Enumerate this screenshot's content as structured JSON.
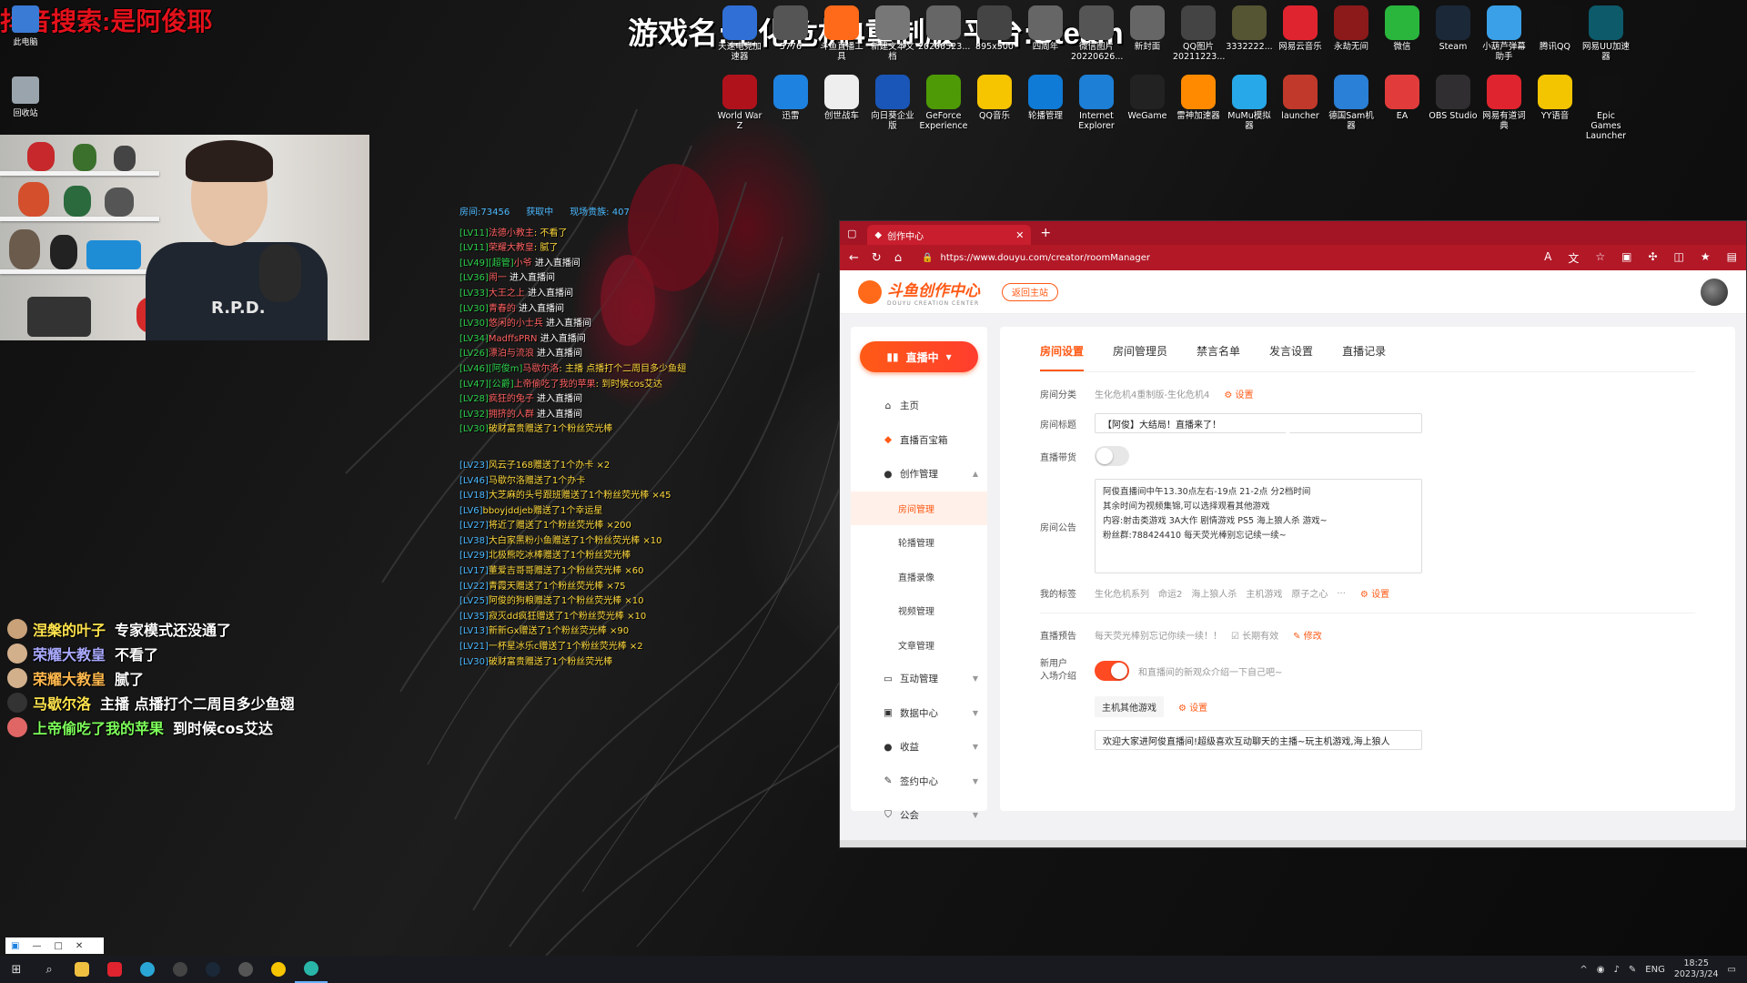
{
  "overlay": {
    "stream_title": "抖音搜索:是阿俊耶",
    "game_title": "游戏名:生化危机4重制版 平台:Steam"
  },
  "left_desktop": [
    {
      "label": "此电脑",
      "icon": "computer-icon"
    },
    {
      "label": "回收站",
      "icon": "recycle-bin-icon"
    }
  ],
  "desktop_icons_row1": [
    {
      "label": "天速电竞加速器",
      "color": "#2f6fd6"
    },
    {
      "label": "5776",
      "color": "#555"
    },
    {
      "label": "斗鱼直播工具",
      "color": "#ff6a1a"
    },
    {
      "label": "新建文本文档",
      "color": "#777"
    },
    {
      "label": "20200523...",
      "color": "#666"
    },
    {
      "label": "895x500",
      "color": "#444"
    },
    {
      "label": "四周年",
      "color": "#666"
    },
    {
      "label": "微信图片20220626...",
      "color": "#555"
    },
    {
      "label": "新封面",
      "color": "#666"
    },
    {
      "label": "QQ图片20211223...",
      "color": "#444"
    },
    {
      "label": "3332222...",
      "color": "#553"
    },
    {
      "label": "网易云音乐",
      "color": "#e0242f"
    },
    {
      "label": "永劫无间",
      "color": "#8c1a1a"
    },
    {
      "label": "微信",
      "color": "#2ab53d"
    },
    {
      "label": "Steam",
      "color": "#1b2838"
    },
    {
      "label": "小葫芦弹幕助手",
      "color": "#3aa0e8"
    },
    {
      "label": "腾讯QQ",
      "color": "#111"
    },
    {
      "label": "网易UU加速器",
      "color": "#0c5a6a"
    }
  ],
  "desktop_icons_row2": [
    {
      "label": "World War Z",
      "color": "#b0121c"
    },
    {
      "label": "迅雷",
      "color": "#1e82e0"
    },
    {
      "label": "创世战车",
      "color": "#eee"
    },
    {
      "label": "向日葵企业版",
      "color": "#1a56b8"
    },
    {
      "label": "GeForce Experience",
      "color": "#4e9a06"
    },
    {
      "label": "QQ音乐",
      "color": "#f7c400"
    },
    {
      "label": "轮播管理",
      "color": "#0f7bd6"
    },
    {
      "label": "Internet Explorer",
      "color": "#1d7fd6"
    },
    {
      "label": "WeGame",
      "color": "#222"
    },
    {
      "label": "雷神加速器",
      "color": "#ff8a00"
    },
    {
      "label": "MuMu模拟器",
      "color": "#27a8e8"
    },
    {
      "label": "launcher",
      "color": "#c0392b"
    },
    {
      "label": "德国Sam机器",
      "color": "#2a7fd6"
    },
    {
      "label": "EA",
      "color": "#e23b3b"
    },
    {
      "label": "OBS Studio",
      "color": "#302e31"
    },
    {
      "label": "网易有道词典",
      "color": "#e0242f"
    },
    {
      "label": "YY语音",
      "color": "#f3c400"
    },
    {
      "label": "Epic Games Launcher",
      "color": "#111"
    }
  ],
  "bullets": [
    {
      "user": "涅槃的叶子",
      "msg": "专家模式还没通了",
      "ucolor": "#ffe44d",
      "av": "#c9a27a"
    },
    {
      "user": "荣耀大教皇",
      "msg": "不看了",
      "ucolor": "#a9a9ff",
      "av": "#d3b08c"
    },
    {
      "user": "荣耀大教皇",
      "msg": "腻了",
      "ucolor": "#ffb84d",
      "av": "#d3b08c"
    },
    {
      "user": "马歇尔洛",
      "msg": "主播 点播打个二周目多少鱼翅",
      "ucolor": "#ffe44d",
      "av": "#333"
    },
    {
      "user": "上帝偷吃了我的苹果",
      "msg": "到时候cos艾达",
      "ucolor": "#7dff5a",
      "av": "#e06666"
    }
  ],
  "chatlog": {
    "header": [
      "房间:73456",
      "获取中",
      "现场贵族: 407"
    ],
    "rows1": [
      {
        "lv": "[LV11]",
        "nm": "法德小教主",
        "txt": ": 不看了",
        "type": "say"
      },
      {
        "lv": "[LV11]",
        "nm": "荣耀大教皇",
        "txt": ": 腻了",
        "type": "say"
      },
      {
        "lv": "[LV49][超管]",
        "nm": "小爷",
        "txt": " 进入直播间",
        "type": "enter"
      },
      {
        "lv": "[LV36]",
        "nm": "闹一",
        "txt": " 进入直播间",
        "type": "enter"
      },
      {
        "lv": "[LV33]",
        "nm": "大王之上",
        "txt": " 进入直播间",
        "type": "enter"
      },
      {
        "lv": "[LV30]",
        "nm": "青春的",
        "txt": " 进入直播间",
        "type": "enter"
      },
      {
        "lv": "[LV30]",
        "nm": "悠闲的小士兵",
        "txt": " 进入直播间",
        "type": "enter"
      },
      {
        "lv": "[LV34]",
        "nm": "MadffsPRN",
        "txt": " 进入直播间",
        "type": "enter"
      },
      {
        "lv": "[LV26]",
        "nm": "漂泊与流浪",
        "txt": " 进入直播间",
        "type": "enter"
      },
      {
        "lv": "[LV46][阿俊m]",
        "nm": "马歇尔洛",
        "txt": ": 主播 点播打个二周目多少鱼翅",
        "type": "say"
      },
      {
        "lv": "[LV47][公爵]",
        "nm": "上帝偷吃了我的苹果",
        "txt": ": 到时候cos艾达",
        "type": "say"
      },
      {
        "lv": "[LV28]",
        "nm": "疯狂的兔子",
        "txt": " 进入直播间",
        "type": "enter"
      },
      {
        "lv": "[LV32]",
        "nm": "拥挤的人群",
        "txt": " 进入直播间",
        "type": "enter"
      },
      {
        "lv": "[LV30]",
        "nm": "",
        "txt": "破财富贵赠送了1个粉丝荧光棒",
        "type": "gift"
      }
    ],
    "rows2": [
      {
        "lv": "[LV23]",
        "txt": "风云子168赠送了1个办卡 ×2"
      },
      {
        "lv": "[LV46]",
        "txt": "马歇尔洛赠送了1个办卡"
      },
      {
        "lv": "[LV18]",
        "txt": "大芝麻的头号跟班赠送了1个粉丝荧光棒 ×45"
      },
      {
        "lv": "[LV6]",
        "txt": "bboyjddjeb赠送了1个幸运星"
      },
      {
        "lv": "[LV27]",
        "txt": "将近了赠送了1个粉丝荧光棒 ×200"
      },
      {
        "lv": "[LV38]",
        "txt": "大白家黑粉小鱼赠送了1个粉丝荧光棒 ×10"
      },
      {
        "lv": "[LV29]",
        "txt": "北极熊吃冰棒赠送了1个粉丝荧光棒"
      },
      {
        "lv": "[LV17]",
        "txt": "董爱吉哥哥赠送了1个粉丝荧光棒 ×60"
      },
      {
        "lv": "[LV22]",
        "txt": "青霞天赠送了1个粉丝荧光棒 ×75"
      },
      {
        "lv": "[LV25]",
        "txt": "阿俊的狗粮赠送了1个粉丝荧光棒 ×10"
      },
      {
        "lv": "[LV35]",
        "txt": "寂灭dd疯狂赠送了1个粉丝荧光棒 ×10"
      },
      {
        "lv": "[LV13]",
        "txt": "新新Gx赠送了1个粉丝荧光棒 ×90"
      },
      {
        "lv": "[LV21]",
        "txt": "一杯星冰乐c赠送了1个粉丝荧光棒 ×2"
      },
      {
        "lv": "[LV30]",
        "txt": "破财富贵赠送了1个粉丝荧光棒"
      }
    ]
  },
  "browser": {
    "tab_title": "创作中心",
    "url": "https://www.douyu.com/creator/roomManager",
    "logo_text": "斗鱼创作中心",
    "logo_sub": "DOUYU CREATION CENTER",
    "back_label": "返回主站",
    "live_label": "直播中",
    "nav": {
      "home": "主页",
      "treasure": "直播百宝箱",
      "creation": "创作管理",
      "sub": [
        "房间管理",
        "轮播管理",
        "直播录像",
        "视频管理",
        "文章管理"
      ],
      "interaction": "互动管理",
      "data": "数据中心",
      "income": "收益",
      "contract": "签约中心",
      "guild": "公会"
    },
    "tabs": [
      "房间设置",
      "房间管理员",
      "禁言名单",
      "发言设置",
      "直播记录"
    ],
    "form": {
      "category_label": "房间分类",
      "category_value": "生化危机4重制版-生化危机4",
      "settings_link": "设置",
      "title_label": "房间标题",
      "title_value": "【阿俊】大结局！直播来了！",
      "goods_label": "直播带货",
      "notice_label": "房间公告",
      "notice_lines": [
        "阿俊直播间中午13.30点左右-19点 21-2点 分2档时间",
        "其余时间为视频集锦,可以选择观看其他游戏",
        "内容:射击类游戏 3A大作 剧情游戏 PS5 海上狼人杀 游戏~",
        "粉丝群:788424410 每天荧光棒别忘记续一续~"
      ],
      "tags_label": "我的标签",
      "tags": [
        "生化危机系列",
        "命运2",
        "海上狼人杀",
        "主机游戏",
        "原子之心",
        "..."
      ],
      "preview_label": "直播预告",
      "preview_value": "每天荧光棒别忘记你续一续！！",
      "long_valid": "长期有效",
      "modify_link": "修改",
      "newuser_label_1": "新用户",
      "newuser_label_2": "入场介绍",
      "newuser_hint": "和直播间的新观众介绍一下自己吧~",
      "chip": "主机其他游戏",
      "intro_value": "欢迎大家进阿俊直播间!超级喜欢互动聊天的主播~玩主机游戏,海上狼人"
    }
  },
  "mini_window": {
    "icon": "app-icon",
    "min": "—",
    "max": "□",
    "close": "✕"
  },
  "taskbar": {
    "lang": "ENG",
    "time": "18:25",
    "date": "2023/3/24"
  }
}
